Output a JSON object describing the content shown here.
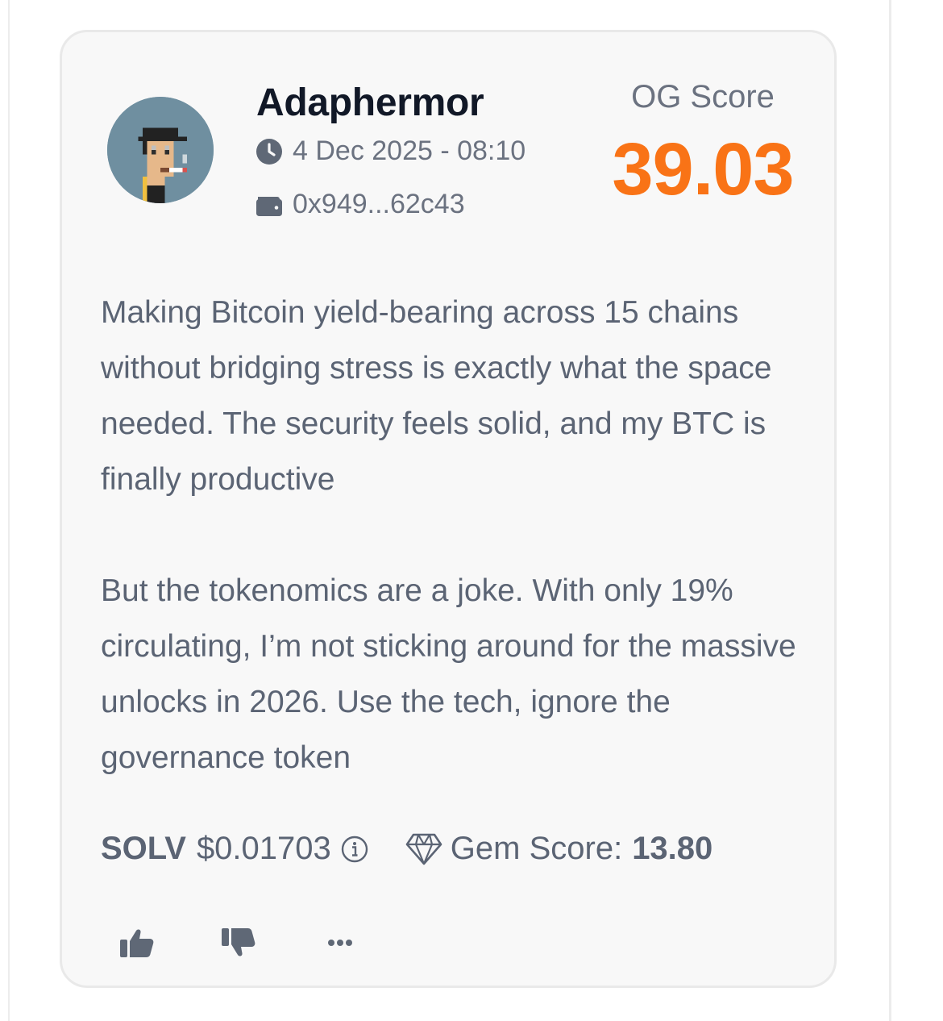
{
  "post": {
    "author": "Adaphermor",
    "timestamp": "4 Dec 2025 - 08:10",
    "wallet": "0x949...62c43",
    "og_score_label": "OG Score",
    "og_score_value": "39.03",
    "body_paragraphs": [
      "Making Bitcoin yield-bearing across 15 chains without bridging stress is exactly what the space needed. The security feels solid, and my BTC is finally productive",
      "But the tokenomics are a joke. With only 19% circulating, I’m not sticking around for the massive unlocks in 2026. Use the tech, ignore the governance token"
    ]
  },
  "token": {
    "symbol": "SOLV",
    "price": "$0.01703",
    "gem_label": "Gem Score:",
    "gem_value": "13.80"
  },
  "icons": {
    "time": "clock-icon",
    "wallet": "wallet-icon",
    "info": "info-icon",
    "gem": "diamond-icon",
    "like": "thumbs-up-icon",
    "dislike": "thumbs-down-icon",
    "more": "more-icon"
  },
  "colors": {
    "accent": "#f97316",
    "text": "#5b6474",
    "heading": "#111827",
    "card_bg": "#f8f8f8"
  }
}
